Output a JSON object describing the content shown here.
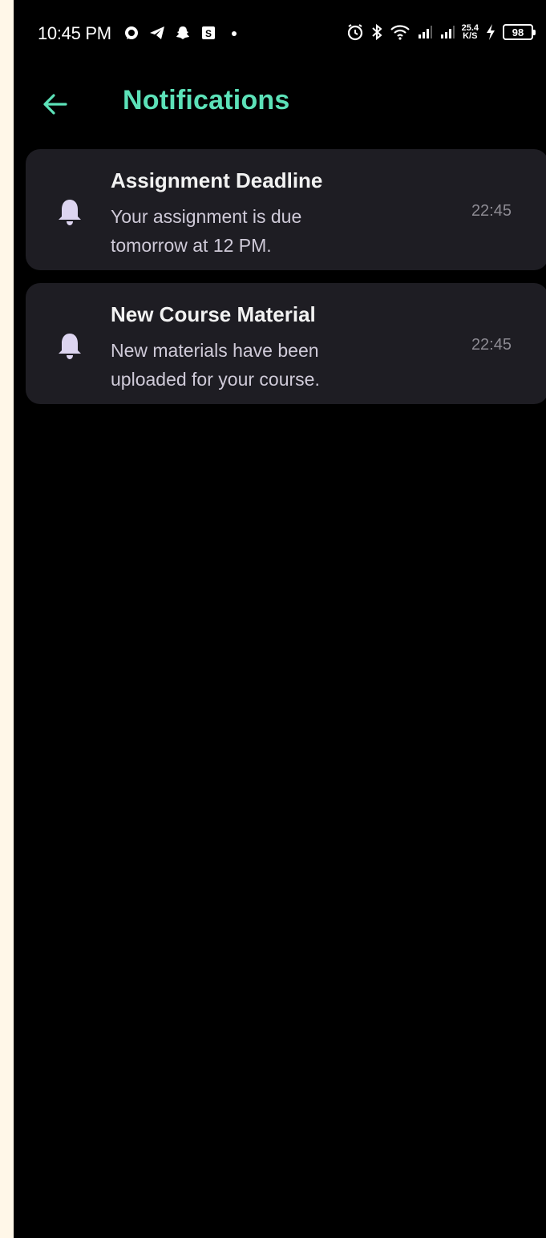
{
  "status_bar": {
    "time": "10:45 PM",
    "left_icons": [
      "whatsapp-icon",
      "telegram-icon",
      "snapchat-icon",
      "s-app-icon",
      "dot-icon"
    ],
    "right_icons": [
      "alarm-icon",
      "bluetooth-icon",
      "wifi-icon",
      "signal-icon",
      "signal-icon"
    ],
    "net_speed_value": "25.4",
    "net_speed_unit": "K/S",
    "battery": "98",
    "charging": true
  },
  "header": {
    "title": "Notifications",
    "accent_color": "#5ce1b8"
  },
  "notifications": [
    {
      "title": "Assignment Deadline",
      "body": "Your assignment is due tomorrow at 12 PM.",
      "time": "22:45",
      "icon": "bell-icon"
    },
    {
      "title": "New Course Material",
      "body": "New materials have been uploaded for your course.",
      "time": "22:45",
      "icon": "bell-icon"
    }
  ],
  "colors": {
    "background": "#000000",
    "card": "#1e1d23",
    "bell": "#ddd5f0",
    "margin": "#fff7e8"
  }
}
